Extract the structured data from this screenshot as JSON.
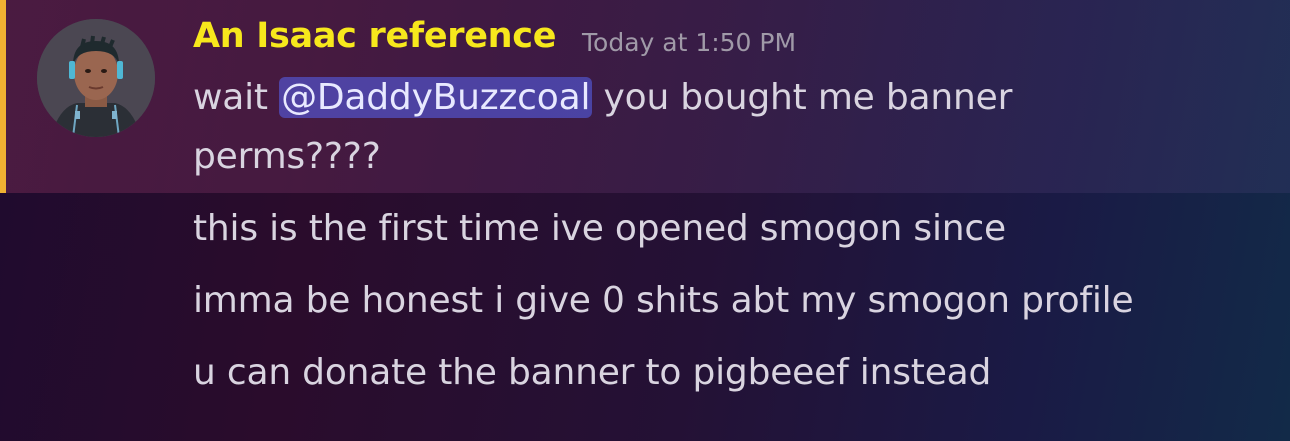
{
  "message": {
    "author": "An Isaac reference",
    "timestamp": "Today at 1:50 PM",
    "first_message": {
      "prefix": "wait ",
      "mention": "@DaddyBuzzcoal",
      "suffix": " you bought me banner",
      "continuation": "perms????"
    },
    "followups": [
      "this is the first time ive opened smogon since",
      "imma be honest i give 0 shits abt my smogon profile",
      "u can donate the banner to pigbeeef instead"
    ]
  },
  "colors": {
    "username": "#f7e81c",
    "highlight_bar": "#f0b132",
    "mention_bg": "#5865f2",
    "text": "#d9d4e0",
    "timestamp": "#a09aa8"
  }
}
